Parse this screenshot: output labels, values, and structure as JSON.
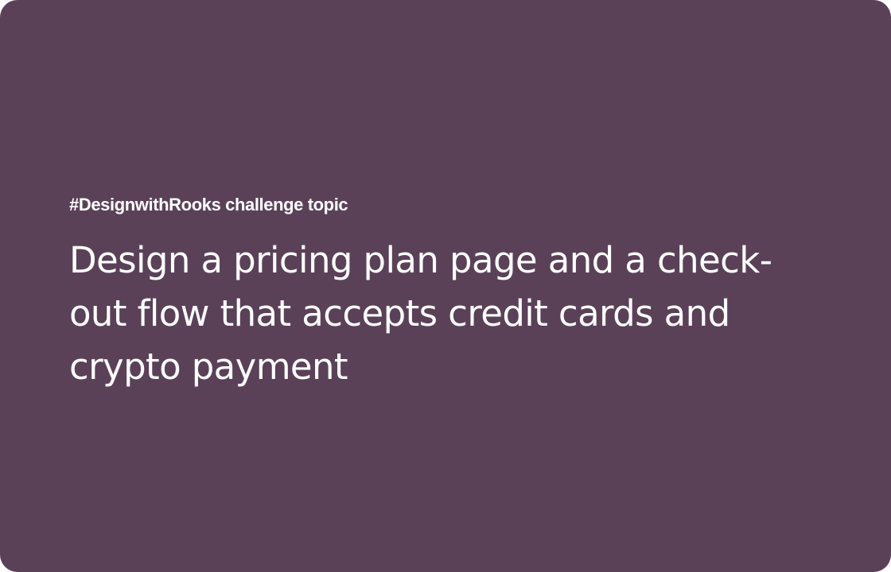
{
  "card": {
    "background": "#5a4158",
    "eyebrow": "#DesignwithRooks challenge topic",
    "headline": "Design a pricing plan page and  a check-out flow that accepts credit cards and crypto payment"
  }
}
